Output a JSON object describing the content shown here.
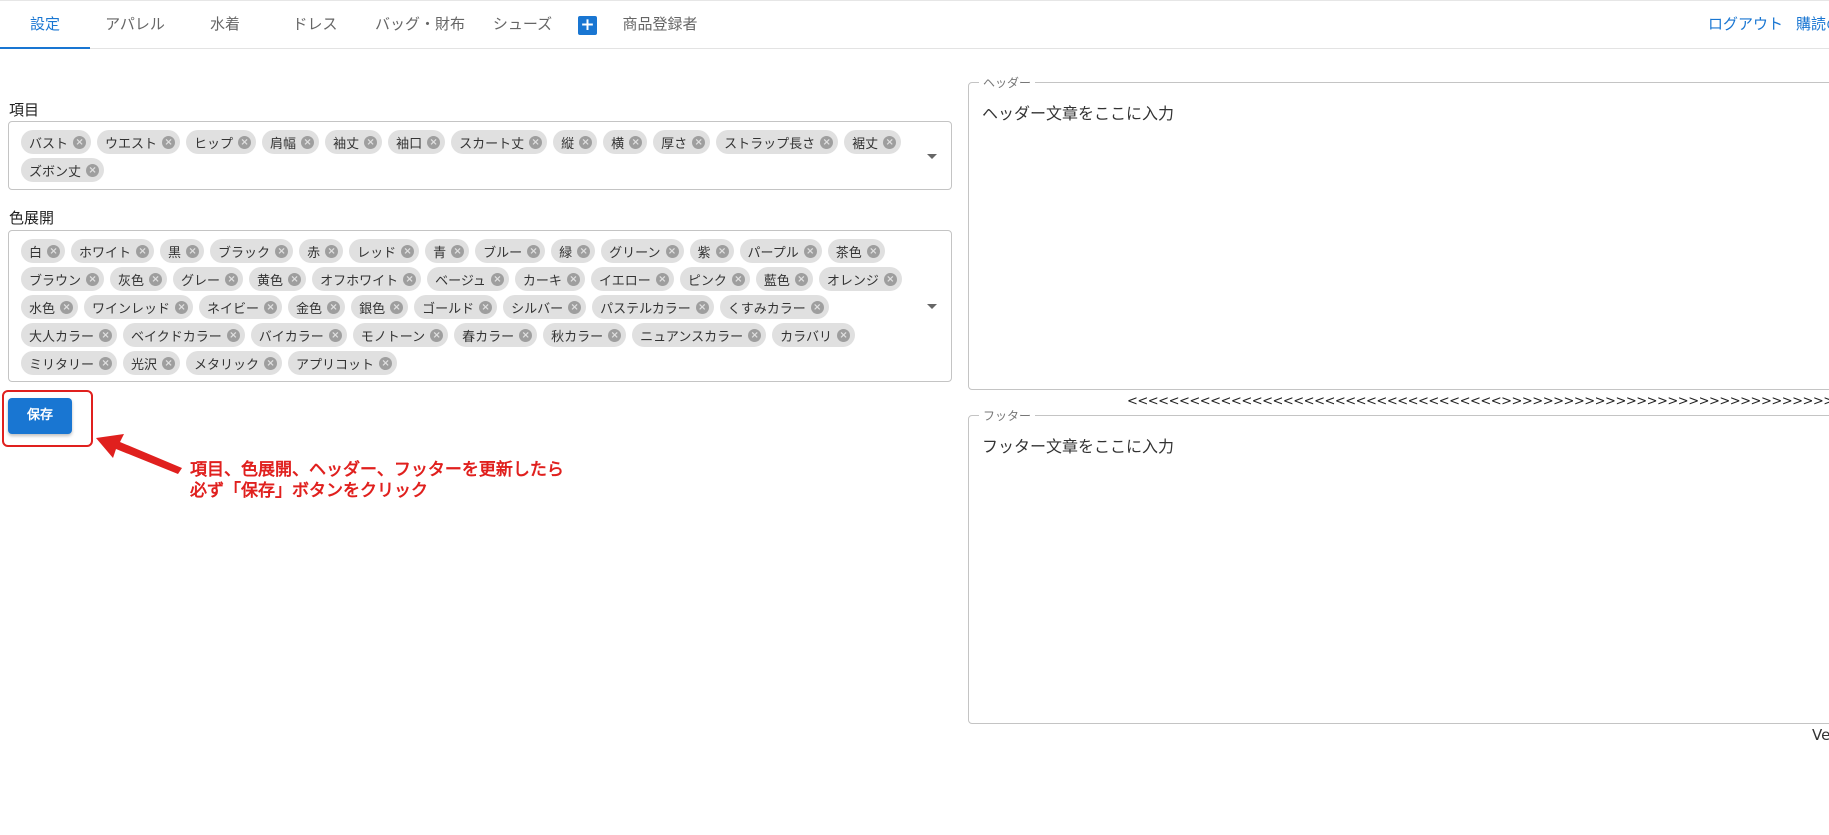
{
  "nav": {
    "tabs": [
      "設定",
      "アパレル",
      "水着",
      "ドレス",
      "バッグ・財布",
      "シューズ"
    ],
    "plus": "+",
    "seller": "商品登録者",
    "logout": "ログアウト",
    "subscribe": "購読の"
  },
  "items": {
    "label": "項目",
    "chips": [
      "バスト",
      "ウエスト",
      "ヒップ",
      "肩幅",
      "袖丈",
      "袖口",
      "スカート丈",
      "縦",
      "横",
      "厚さ",
      "ストラップ長さ",
      "裾丈",
      "ズボン丈"
    ]
  },
  "colors": {
    "label": "色展開",
    "chips": [
      "白",
      "ホワイト",
      "黒",
      "ブラック",
      "赤",
      "レッド",
      "青",
      "ブルー",
      "緑",
      "グリーン",
      "紫",
      "パープル",
      "茶色",
      "ブラウン",
      "灰色",
      "グレー",
      "黄色",
      "オフホワイト",
      "ベージュ",
      "カーキ",
      "イエロー",
      "ピンク",
      "藍色",
      "オレンジ",
      "水色",
      "ワインレッド",
      "ネイビー",
      "金色",
      "銀色",
      "ゴールド",
      "シルバー",
      "パステルカラー",
      "くすみカラー",
      "大人カラー",
      "ベイクドカラー",
      "バイカラー",
      "モノトーン",
      "春カラー",
      "秋カラー",
      "ニュアンスカラー",
      "カラバリ",
      "ミリタリー",
      "光沢",
      "メタリック",
      "アプリコット"
    ]
  },
  "save_label": "保存",
  "annotation": {
    "line1": "項目、色展開、ヘッダー、フッターを更新したら",
    "line2": "必ず「保存」ボタンをクリック"
  },
  "header": {
    "legend": "ヘッダー",
    "text": "ヘッダー文章をここに入力"
  },
  "separator": "<<<<<<<<<<<<<<<<<<<<<<<<<<<<<<<<<<<<>>>>>>>>>>>>>>>>>>>>>>>>>>>>>>>>>>>",
  "footer": {
    "legend": "フッター",
    "text": "フッター文章をここに入力"
  },
  "version_label": "Ve",
  "colors_theme": {
    "accent": "#1976d2",
    "annotation": "#e0201e"
  }
}
